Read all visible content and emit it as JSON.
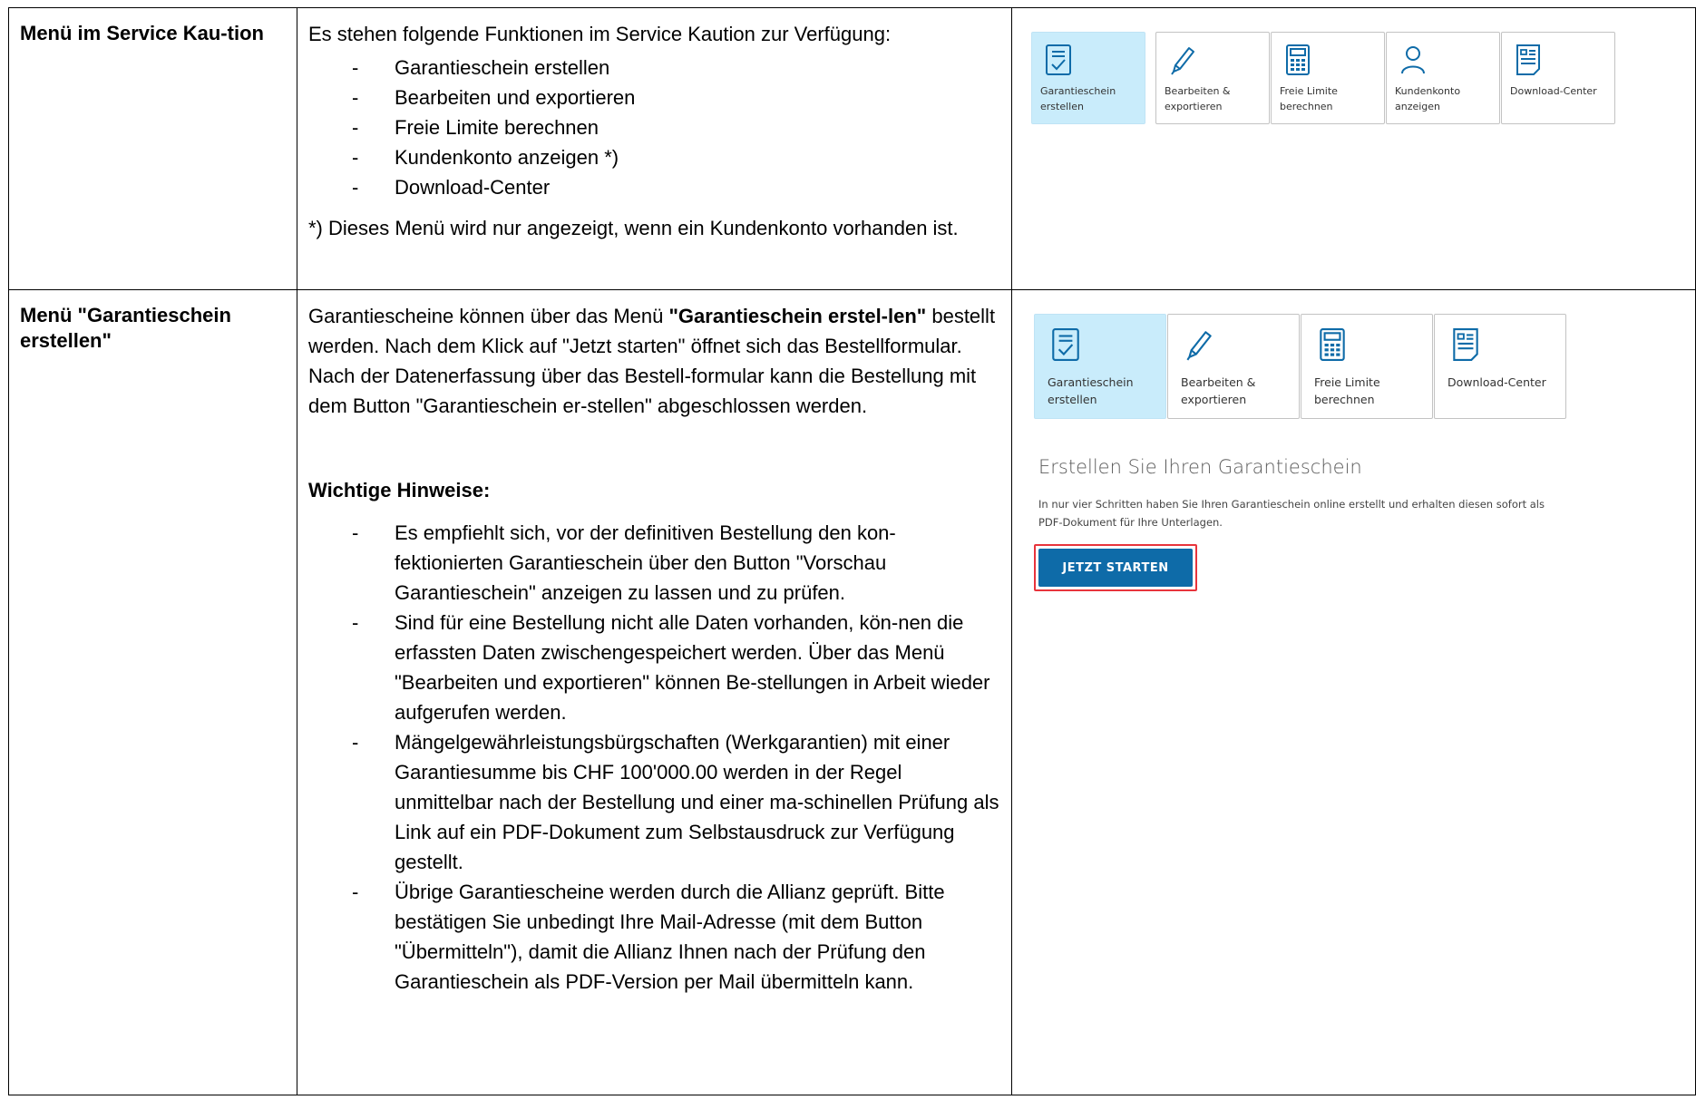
{
  "row1": {
    "label": "Menü im Service Kau-tion",
    "intro": "Es stehen folgende Funktionen im Service Kaution zur Verfügung:",
    "items": [
      "Garantieschein erstellen",
      "Bearbeiten und exportieren",
      "Freie Limite berechnen",
      "Kundenkonto anzeigen *)",
      "Download-Center"
    ],
    "footnote": "*) Dieses Menü wird nur angezeigt, wenn ein Kundenkonto vorhanden ist.",
    "tiles": [
      {
        "icon": "document-check-icon",
        "line1": "Garantieschein",
        "line2": "erstellen",
        "active": true
      },
      {
        "icon": "pen-icon",
        "line1": "Bearbeiten &",
        "line2": "exportieren",
        "active": false
      },
      {
        "icon": "calculator-icon",
        "line1": "Freie Limite",
        "line2": "berechnen",
        "active": false
      },
      {
        "icon": "user-icon",
        "line1": "Kundenkonto",
        "line2": "anzeigen",
        "active": false
      },
      {
        "icon": "download-document-icon",
        "line1": "Download-Center",
        "line2": "",
        "active": false
      }
    ]
  },
  "row2": {
    "label": "Menü \"Garantieschein erstellen\"",
    "text_part1": "Garantiescheine können über das Menü ",
    "text_bold": "\"Garantieschein erstel-len\"",
    "text_part2": " bestellt werden. Nach dem Klick auf \"Jetzt starten\" öffnet sich das Bestellformular. Nach der Datenerfassung über das Bestell-formular kann die Bestellung mit dem Button \"Garantieschein er-stellen\" abgeschlossen werden.",
    "hinweise_title": "Wichtige Hinweise:",
    "hinweise": [
      "Es empfiehlt sich, vor der definitiven Bestellung den kon-fektionierten Garantieschein über den Button \"Vorschau Garantieschein\" anzeigen zu lassen und zu prüfen.",
      "Sind für eine Bestellung nicht alle Daten vorhanden, kön-nen die erfassten Daten zwischengespeichert werden. Über das Menü \"Bearbeiten und exportieren\" können Be-stellungen in Arbeit wieder aufgerufen werden.",
      "Mängelgewährleistungsbürgschaften (Werkgarantien) mit einer Garantiesumme bis CHF 100'000.00 werden in der Regel unmittelbar nach der Bestellung und einer ma-schinellen Prüfung als Link auf ein PDF-Dokument zum Selbstausdruck zur Verfügung gestellt.",
      "Übrige Garantiescheine werden durch die Allianz geprüft. Bitte bestätigen Sie unbedingt Ihre Mail-Adresse (mit dem Button \"Übermitteln\"), damit die Allianz Ihnen nach der Prüfung den Garantieschein als PDF-Version per Mail übermitteln kann."
    ],
    "tiles": [
      {
        "icon": "document-check-icon",
        "line1": "Garantieschein",
        "line2": "erstellen",
        "active": true
      },
      {
        "icon": "pen-icon",
        "line1": "Bearbeiten &",
        "line2": "exportieren",
        "active": false
      },
      {
        "icon": "calculator-icon",
        "line1": "Freie Limite",
        "line2": "berechnen",
        "active": false
      },
      {
        "icon": "download-document-icon",
        "line1": "Download-Center",
        "line2": "",
        "active": false
      }
    ],
    "ui_heading": "Erstellen Sie Ihren Garantieschein",
    "ui_desc": "In nur vier Schritten haben Sie Ihren Garantieschein online erstellt und erhalten diesen sofort als PDF-Dokument für Ihre Unterlagen.",
    "start_button": "JETZT STARTEN"
  },
  "colors": {
    "active_tile": "#c9ecfb",
    "icon_blue": "#0e6ba8",
    "button": "#0e6ba8",
    "highlight": "#e8343c"
  }
}
